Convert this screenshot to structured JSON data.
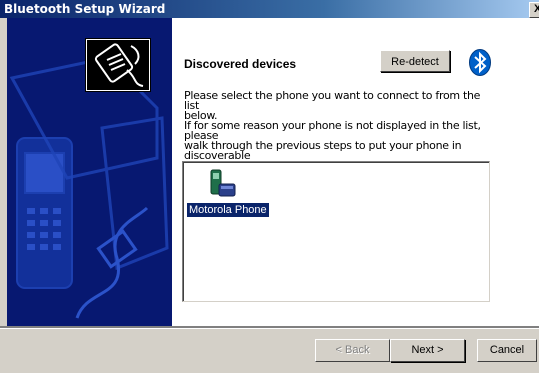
{
  "window": {
    "title": "Bluetooth Setup Wizard",
    "close_glyph": "X"
  },
  "page": {
    "heading": "Discovered devices",
    "redetect_label": "Re-detect",
    "instructions": "Please select the phone you want to connect to from the list\nbelow.\nIf for some reason your phone is not displayed in the list, please\nwalk through the previous steps to put your phone in discoverable\nmode."
  },
  "devices": [
    {
      "label": "Motorola Phone",
      "icon": "mobile-phone-icon",
      "selected": true
    }
  ],
  "footer": {
    "back_label": "< Back",
    "next_label": "Next >",
    "cancel_label": "Cancel"
  },
  "colors": {
    "title_bar": "#0a246a",
    "side_panel": "#041366",
    "selection": "#0a246a",
    "bluetooth": "#0060c8"
  }
}
